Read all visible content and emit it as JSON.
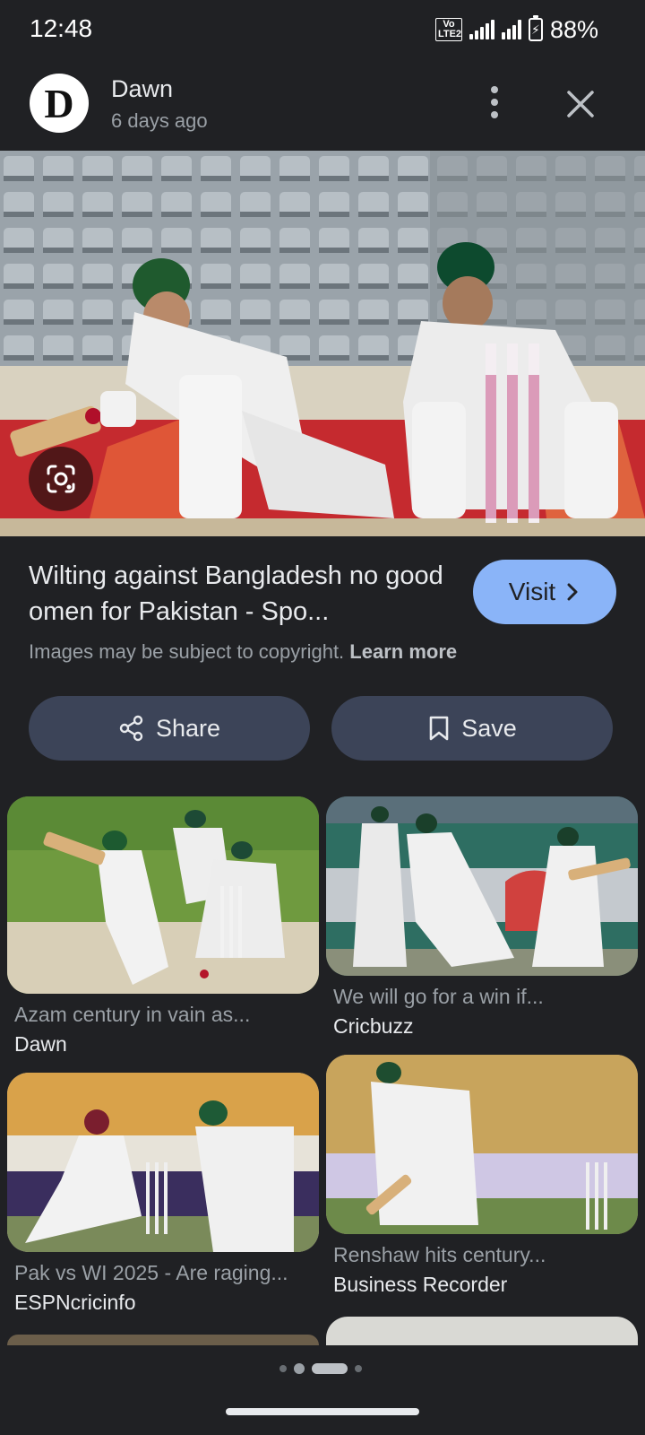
{
  "status_bar": {
    "time": "12:48",
    "network": "VoLTE2",
    "network_type": "4G",
    "battery_percent": "88%"
  },
  "header": {
    "source_logo_letter": "D",
    "source_name": "Dawn",
    "age": "6 days ago",
    "more_icon": "more-vert-icon",
    "close_icon": "close-icon"
  },
  "hero": {
    "lens_icon": "google-lens-icon"
  },
  "result": {
    "title": "Wilting against Bangladesh no good omen for Pakistan - Spo...",
    "visit_label": "Visit",
    "copyright_text": "Images may be subject to copyright.",
    "learn_more": "Learn more"
  },
  "actions": {
    "share_label": "Share",
    "save_label": "Save"
  },
  "related": [
    {
      "caption": "Azam century in vain as...",
      "site": "Dawn"
    },
    {
      "caption": "We will go for a win if...",
      "site": "Cricbuzz"
    },
    {
      "caption": "Pak vs WI 2025 - Are raging...",
      "site": "ESPNcricinfo"
    },
    {
      "caption": "Renshaw hits century...",
      "site": "Business Recorder"
    }
  ],
  "pager": {
    "pages": 4,
    "active_index": 2
  }
}
